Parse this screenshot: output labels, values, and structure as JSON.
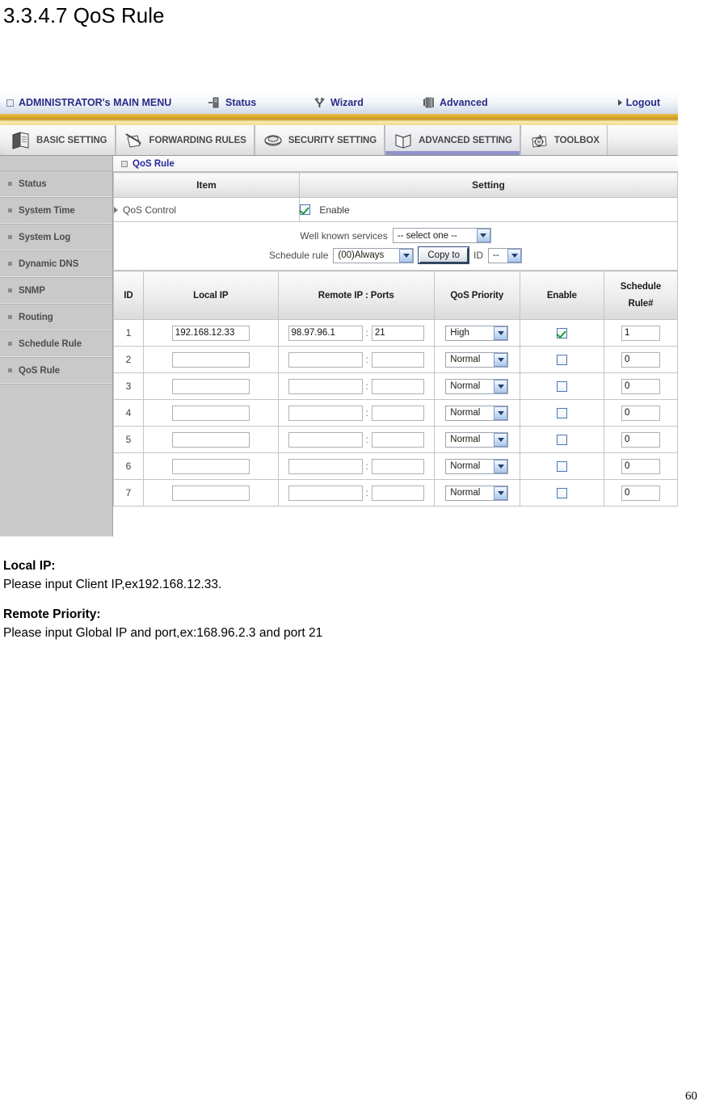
{
  "document": {
    "title": "3.3.4.7 QoS Rule",
    "page_number": "60"
  },
  "router_ui": {
    "top_menu": {
      "admin_label": "ADMINISTRATOR's MAIN MENU",
      "items": [
        {
          "label": "Status",
          "icon": "status-icon"
        },
        {
          "label": "Wizard",
          "icon": "wizard-icon"
        },
        {
          "label": "Advanced",
          "icon": "advanced-icon"
        }
      ],
      "logout_label": "Logout"
    },
    "tabs": [
      {
        "label": "BASIC SETTING",
        "icon": "documents-icon",
        "active": false
      },
      {
        "label": "FORWARDING RULES",
        "icon": "pencil-paper-icon",
        "active": false
      },
      {
        "label": "SECURITY SETTING",
        "icon": "shield-icon",
        "active": false
      },
      {
        "label": "ADVANCED SETTING",
        "icon": "open-book-icon",
        "active": true
      },
      {
        "label": "TOOLBOX",
        "icon": "toolbox-gear-icon",
        "active": false
      }
    ],
    "sidebar": {
      "items": [
        {
          "label": "Status"
        },
        {
          "label": "System Time"
        },
        {
          "label": "System Log"
        },
        {
          "label": "Dynamic DNS"
        },
        {
          "label": "SNMP"
        },
        {
          "label": "Routing"
        },
        {
          "label": "Schedule Rule"
        },
        {
          "label": "QoS Rule"
        }
      ]
    },
    "panel": {
      "section_title": "QoS Rule",
      "item_header": "Item",
      "setting_header": "Setting",
      "qos_control_label": "QoS Control",
      "qos_control_enable_label": "Enable",
      "qos_control_enabled": true,
      "well_known_services_label": "Well known services",
      "well_known_services_value": "-- select one --",
      "schedule_rule_label": "Schedule rule",
      "schedule_rule_value": "(00)Always",
      "copy_to_button": "Copy to",
      "id_label": "ID",
      "id_value": "--"
    },
    "rules_table": {
      "columns": [
        "ID",
        "Local IP",
        "Remote IP : Ports",
        "QoS Priority",
        "Enable",
        "Schedule Rule#"
      ],
      "schedule_col_line1": "Schedule",
      "schedule_col_line2": "Rule#",
      "rows": [
        {
          "id": "1",
          "local_ip": "192.168.12.33",
          "remote_ip": "98.97.96.1",
          "port": "21",
          "priority": "High",
          "enable": true,
          "schedule_rule": "1"
        },
        {
          "id": "2",
          "local_ip": "",
          "remote_ip": "",
          "port": "",
          "priority": "Normal",
          "enable": false,
          "schedule_rule": "0"
        },
        {
          "id": "3",
          "local_ip": "",
          "remote_ip": "",
          "port": "",
          "priority": "Normal",
          "enable": false,
          "schedule_rule": "0"
        },
        {
          "id": "4",
          "local_ip": "",
          "remote_ip": "",
          "port": "",
          "priority": "Normal",
          "enable": false,
          "schedule_rule": "0"
        },
        {
          "id": "5",
          "local_ip": "",
          "remote_ip": "",
          "port": "",
          "priority": "Normal",
          "enable": false,
          "schedule_rule": "0"
        },
        {
          "id": "6",
          "local_ip": "",
          "remote_ip": "",
          "port": "",
          "priority": "Normal",
          "enable": false,
          "schedule_rule": "0"
        },
        {
          "id": "7",
          "local_ip": "",
          "remote_ip": "",
          "port": "",
          "priority": "Normal",
          "enable": false,
          "schedule_rule": "0"
        }
      ]
    }
  },
  "notes": [
    {
      "heading": "Local IP:",
      "text": "Please input Client IP,ex192.168.12.33."
    },
    {
      "heading": "Remote Priority:",
      "text": "Please input Global IP and port,ex:168.96.2.3 and port 21"
    }
  ],
  "colors": {
    "menu_blue": "#2a2a8c",
    "gold_bar": "#d9a72c",
    "active_tab_underline": "#8f93c8",
    "section_title": "#2727a0",
    "sidebar_bg": "#c9c9c9",
    "check_green": "#1f9d36"
  }
}
